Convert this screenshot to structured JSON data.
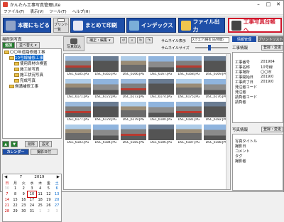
{
  "window": {
    "title": "かんたん工事写真管理Lite"
  },
  "menu": [
    "ファイル(F)",
    "表示(V)",
    "ツール(T)",
    "ヘルプ(H)"
  ],
  "toolbar": {
    "home": "本棚にもどる",
    "print_list": "プリント一覧",
    "print_all": "まとめて印刷",
    "index": "インデックス",
    "file_output": "ファイル出力",
    "ledger": "工事写真台帳へ"
  },
  "left": {
    "tree_title": "場所別写真",
    "add_label": "追加",
    "sort_label": "並べ替え",
    "tree": [
      {
        "label": "〇〇年道路修繕工事",
        "level": 0,
        "selected": false
      },
      {
        "label": "10号線補修工事",
        "level": 1,
        "selected": true
      },
      {
        "label": "使用資材の検査",
        "level": 2,
        "selected": false
      },
      {
        "label": "施工前写真",
        "level": 2,
        "selected": false
      },
      {
        "label": "施工状況写真",
        "level": 2,
        "selected": false
      },
      {
        "label": "完成写真",
        "level": 2,
        "selected": false
      },
      {
        "label": "側溝補修工事",
        "level": 1,
        "selected": false
      }
    ],
    "delete_label": "削除",
    "settings_label": "設定",
    "calendar_btn": "カレンダー",
    "shoot_date_btn": "撮影日付",
    "calendar": {
      "month": "7",
      "year": "2019",
      "weekdays": [
        "日",
        "月",
        "火",
        "水",
        "木",
        "金",
        "土"
      ],
      "weeks": [
        [
          "30",
          "1",
          "2",
          "3",
          "4",
          "5",
          "6"
        ],
        [
          "7",
          "8",
          "9",
          "10",
          "11",
          "12",
          "13"
        ],
        [
          "14",
          "15",
          "16",
          "17",
          "18",
          "19",
          "20"
        ],
        [
          "21",
          "22",
          "23",
          "24",
          "25",
          "26",
          "27"
        ],
        [
          "28",
          "29",
          "30",
          "31",
          "1",
          "2",
          "3"
        ]
      ]
    }
  },
  "center": {
    "photo_import": "写真取込",
    "edit_label": "補正・編集",
    "thumb_display_label": "サムネイル表示",
    "thumb_display_value": "スクエア(横長 日/時間)",
    "thumb_size_label": "サムネイルサイズ",
    "photos": [
      "DSC_6185.JPG",
      "DSC_6165.JPG",
      "DSC_6166.JPG",
      "DSC_6167.JPG",
      "DSC_6168.JPG",
      "DSC_6169.JPG",
      "DSC_6171.JPG",
      "DSC_6172.JPG",
      "DSC_6173.JPG",
      "DSC_6174.JPG",
      "DSC_6175.JPG",
      "DSC_6176.JPG",
      "DSC_6177.JPG",
      "DSC_6178.JPG",
      "DSC_6179.JPG",
      "DSC_6180.JPG",
      "DSC_6181.JPG",
      "DSC_6182.JPG",
      "DSC_6183.JPG",
      "DSC_6184.JPG",
      "DSC_6185.JPG",
      "DSC_6186.JPG",
      "DSC_6187.JPG",
      "DSC_6188.JPG"
    ]
  },
  "right": {
    "tab_info": "情報管理",
    "tab_print": "プリントリスト",
    "project_info_label": "工事情報",
    "register_btn": "登録・変更",
    "project_fields": [
      {
        "k": "工事番号",
        "v": "201904"
      },
      {
        "k": "工事名称",
        "v": "10号線"
      },
      {
        "k": "工事場所",
        "v": "〇〇市"
      },
      {
        "k": "工事開始日",
        "v": "2019/0"
      },
      {
        "k": "工事終了日",
        "v": "2019/0"
      },
      {
        "k": "発注者コード",
        "v": ""
      },
      {
        "k": "発注者",
        "v": ""
      },
      {
        "k": "請負者コード",
        "v": ""
      },
      {
        "k": "請負者",
        "v": ""
      }
    ],
    "photo_info_label": "写真情報",
    "photo_fields": [
      {
        "k": "写真タイトル",
        "v": ""
      },
      {
        "k": "撮影日",
        "v": ""
      },
      {
        "k": "コメント",
        "v": ""
      },
      {
        "k": "タグ",
        "v": ""
      },
      {
        "k": "撮影者",
        "v": ""
      }
    ]
  }
}
